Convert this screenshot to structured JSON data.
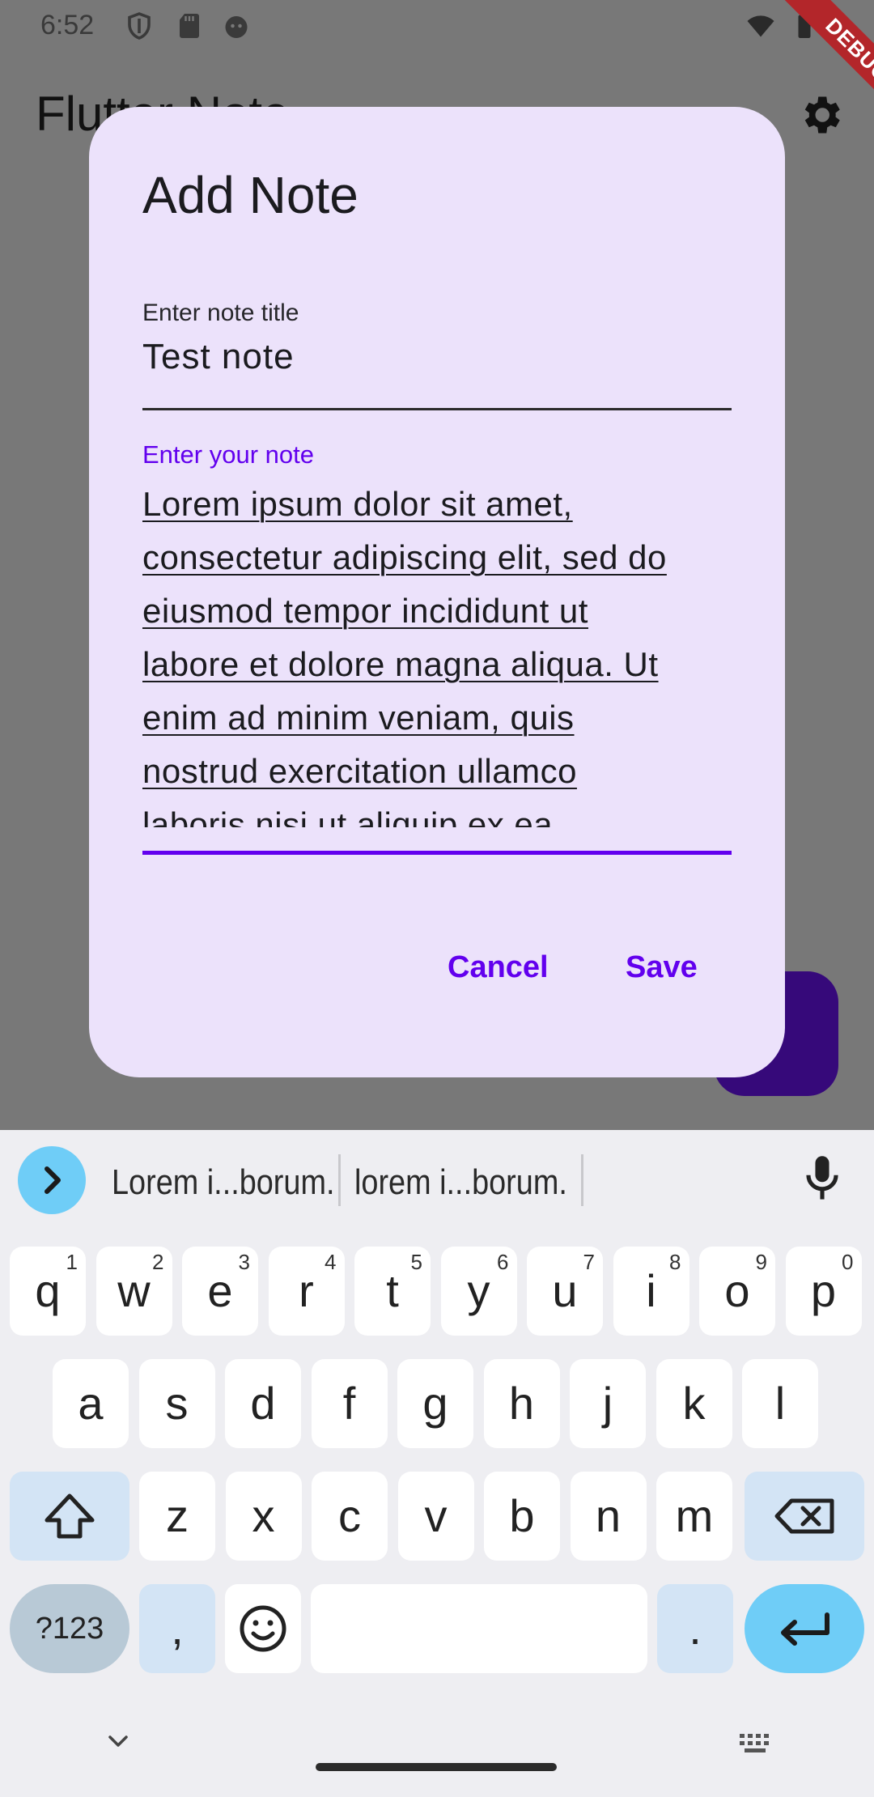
{
  "status_bar": {
    "time": "6:52"
  },
  "app_bar": {
    "title": "Flutter Note"
  },
  "debug_banner": {
    "label": "DEBUG"
  },
  "dialog": {
    "title": "Add Note",
    "title_field": {
      "label": "Enter note title",
      "value": "Test note"
    },
    "note_field": {
      "label": "Enter your note",
      "value": "Lorem ipsum dolor sit amet,\nconsectetur adipiscing elit, sed do\neiusmod tempor incididunt ut\nlabore et dolore magna aliqua. Ut\nenim ad minim veniam, quis\nnostrud exercitation ullamco\nlaboris nisi ut aliquip ex ea"
    },
    "cancel_label": "Cancel",
    "save_label": "Save"
  },
  "keyboard": {
    "suggestions": [
      "Lorem i...borum.",
      "lorem i...borum."
    ],
    "row1": [
      {
        "k": "q",
        "h": "1"
      },
      {
        "k": "w",
        "h": "2"
      },
      {
        "k": "e",
        "h": "3"
      },
      {
        "k": "r",
        "h": "4"
      },
      {
        "k": "t",
        "h": "5"
      },
      {
        "k": "y",
        "h": "6"
      },
      {
        "k": "u",
        "h": "7"
      },
      {
        "k": "i",
        "h": "8"
      },
      {
        "k": "o",
        "h": "9"
      },
      {
        "k": "p",
        "h": "0"
      }
    ],
    "row2": [
      "a",
      "s",
      "d",
      "f",
      "g",
      "h",
      "j",
      "k",
      "l"
    ],
    "row3": [
      "z",
      "x",
      "c",
      "v",
      "b",
      "n",
      "m"
    ],
    "symbols_label": "?123",
    "comma_label": ",",
    "period_label": "."
  },
  "colors": {
    "accent": "#6200ee",
    "dialog_bg": "#ece2fb",
    "scrim": "#787878",
    "fab": "#36097a"
  }
}
